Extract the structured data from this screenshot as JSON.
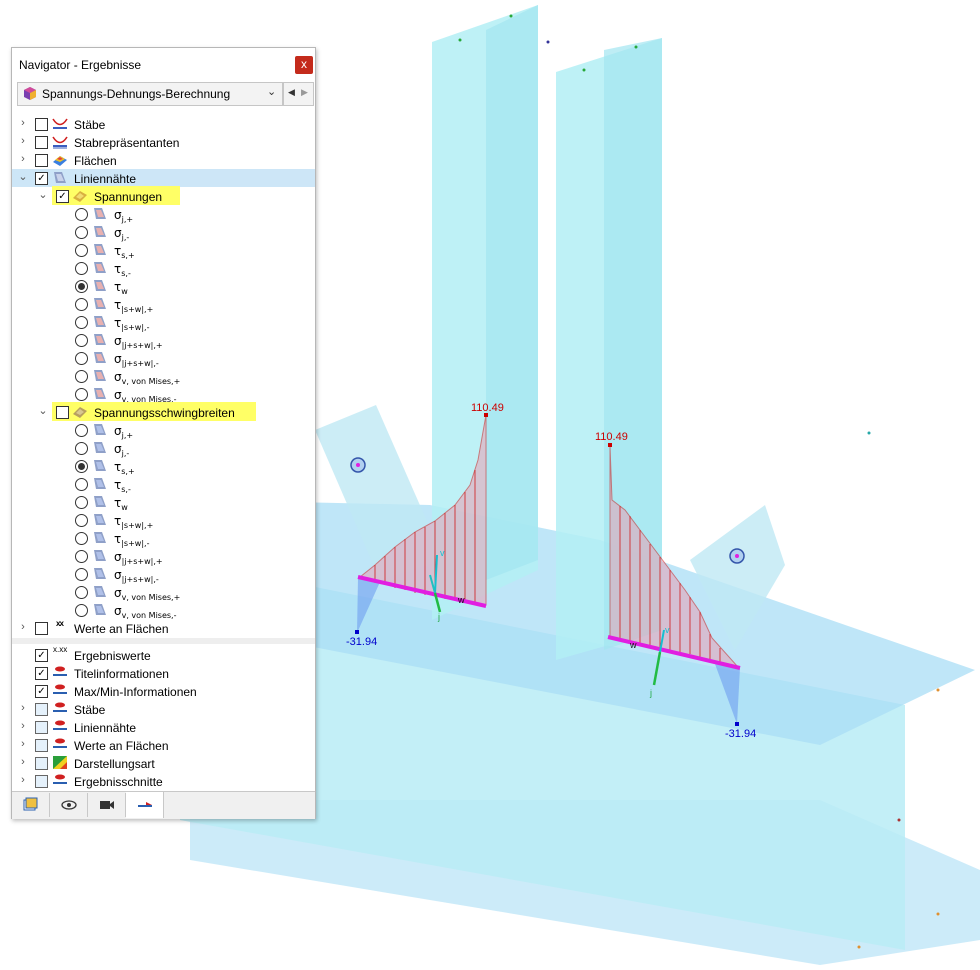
{
  "viewport": {
    "annotations": [
      {
        "text": "110.49"
      },
      {
        "text": "110.49"
      },
      {
        "text": "-31.94"
      },
      {
        "text": "-31.94"
      }
    ],
    "axis_labels": [
      "v",
      "w",
      "j",
      "v",
      "w",
      "j"
    ]
  },
  "navigator": {
    "title": "Navigator - Ergebnisse",
    "close_glyph": "x",
    "combo_value": "Spannungs-Dehnungs-Berechnung",
    "tree": {
      "items": [
        {
          "label": "Stäbe",
          "checked": false
        },
        {
          "label": "Stabrepräsentanten",
          "checked": false
        },
        {
          "label": "Flächen",
          "checked": false
        },
        {
          "label": "Liniennähte",
          "checked": true
        }
      ],
      "group1": {
        "label": "Spannungen",
        "checked": true
      },
      "stresses": [
        {
          "sym": "σ",
          "sub": "j,+"
        },
        {
          "sym": "σ",
          "sub": "j,-"
        },
        {
          "sym": "τ",
          "sub": "s,+"
        },
        {
          "sym": "τ",
          "sub": "s,-"
        },
        {
          "sym": "τ",
          "sub": "w"
        },
        {
          "sym": "τ",
          "sub": "|s+w|,+"
        },
        {
          "sym": "τ",
          "sub": "|s+w|,-"
        },
        {
          "sym": "σ",
          "sub": "|j+s+w|,+"
        },
        {
          "sym": "σ",
          "sub": "|j+s+w|,-"
        },
        {
          "sym": "σ",
          "sub": "v, von Mises,+"
        },
        {
          "sym": "σ",
          "sub": "v, von Mises,-"
        }
      ],
      "stresses_selected": "τw",
      "group2": {
        "label": "Spannungsschwingbreiten",
        "checked": false
      },
      "ranges": [
        {
          "sym": "σ",
          "sub": "j,+"
        },
        {
          "sym": "σ",
          "sub": "j,-"
        },
        {
          "sym": "τ",
          "sub": "s,+"
        },
        {
          "sym": "τ",
          "sub": "s,-"
        },
        {
          "sym": "τ",
          "sub": "w"
        },
        {
          "sym": "τ",
          "sub": "|s+w|,+"
        },
        {
          "sym": "τ",
          "sub": "|s+w|,-"
        },
        {
          "sym": "σ",
          "sub": "|j+s+w|,+"
        },
        {
          "sym": "σ",
          "sub": "|j+s+w|,-"
        },
        {
          "sym": "σ",
          "sub": "v, von Mises,+"
        },
        {
          "sym": "σ",
          "sub": "v, von Mises,-"
        }
      ],
      "ranges_selected": "τs,+",
      "surface_values": {
        "label": "Werte an Flächen",
        "icon_text": "xx",
        "checked": false
      }
    },
    "display": [
      {
        "label": "Ergebniswerte",
        "icon_text": "x.xx",
        "checked": true
      },
      {
        "label": "Titelinformationen",
        "checked": true
      },
      {
        "label": "Max/Min-Informationen",
        "checked": true
      },
      {
        "label": "Stäbe",
        "checked": false
      },
      {
        "label": "Liniennähte",
        "checked": false
      },
      {
        "label": "Werte an Flächen",
        "checked": false
      },
      {
        "label": "Darstellungsart",
        "checked": false
      },
      {
        "label": "Ergebnisschnitte",
        "checked": false
      }
    ],
    "tabs": [
      {
        "name": "data-tab-icon"
      },
      {
        "name": "view-eye-icon"
      },
      {
        "name": "camera-icon"
      },
      {
        "name": "results-icon",
        "active": true
      }
    ]
  },
  "colors": {
    "plate": "#9fe4f0",
    "weld_line": "#e11ee1",
    "positive_fill": "#e8a0b4",
    "positive_stroke": "#d01818",
    "negative_fill": "#6f9ff0",
    "max_label": "#cc0000",
    "min_label": "#0000cc",
    "selection_row": "#cde6f7",
    "highlight": "#ffff66",
    "arrow": "#1c2cdc"
  }
}
